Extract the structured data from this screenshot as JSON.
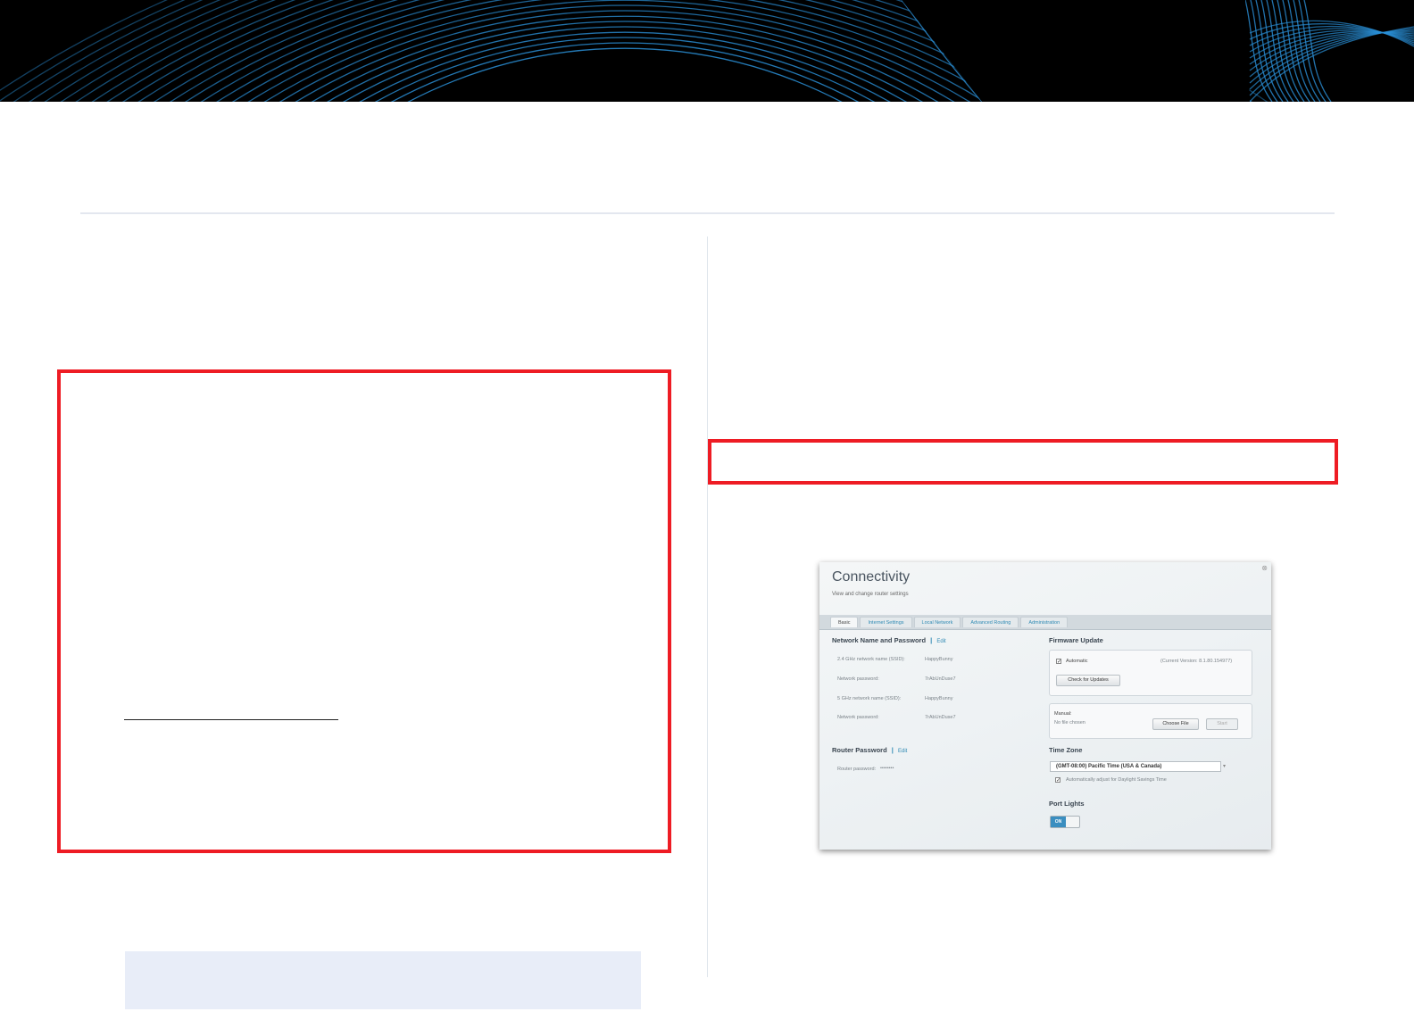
{
  "colors": {
    "accent_red": "#ee1c24",
    "header_bg": "#000000",
    "arc_blue": "#2a8fd6",
    "link_blue": "#2f8ab4"
  },
  "screenshot": {
    "close_icon": "close-icon",
    "title": "Connectivity",
    "subtitle": "View and change router settings",
    "tabs": [
      "Basic",
      "Internet Settings",
      "Local Network",
      "Advanced Routing",
      "Administration"
    ],
    "active_tab": 0,
    "network_section": {
      "heading": "Network Name and Password",
      "edit": "Edit",
      "rows": [
        {
          "label": "2.4 GHz network name (SSID):",
          "value": "HappyBunny"
        },
        {
          "label": "Network password:",
          "value": "7rAbUnDuse7"
        },
        {
          "label": "5 GHz network name (SSID):",
          "value": "HappyBunny"
        },
        {
          "label": "Network password:",
          "value": "7rAbUnDuse7"
        }
      ]
    },
    "router_password": {
      "heading": "Router Password",
      "edit": "Edit",
      "label": "Router password:",
      "value": "••••••••"
    },
    "firmware": {
      "heading": "Firmware Update",
      "automatic_label": "Automatic",
      "automatic_checked": true,
      "current_version": "(Current Version: 8.1.80.154977)",
      "check_button": "Check for Updates",
      "manual_label": "Manual:",
      "no_file": "No file chosen",
      "choose_file_button": "Choose File",
      "start_button": "Start"
    },
    "time_zone": {
      "heading": "Time Zone",
      "selected": "(GMT-08:00) Pacific Time (USA & Canada)",
      "dst_label": "Automatically adjust for Daylight Savings Time",
      "dst_checked": true
    },
    "port_lights": {
      "heading": "Port Lights",
      "state": "ON"
    }
  }
}
